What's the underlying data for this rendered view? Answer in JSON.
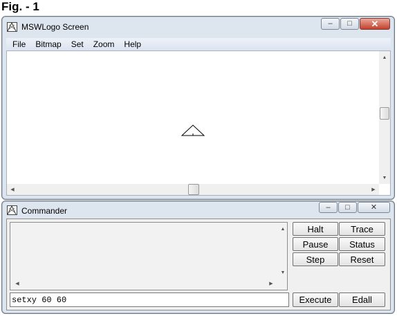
{
  "caption": "Fig. - 1",
  "screen_window": {
    "title": "MSWLogo Screen",
    "menu": [
      "File",
      "Bitmap",
      "Set",
      "Zoom",
      "Help"
    ]
  },
  "commander_window": {
    "title": "Commander",
    "buttons": {
      "halt": "Halt",
      "trace": "Trace",
      "pause": "Pause",
      "status": "Status",
      "step": "Step",
      "reset": "Reset",
      "execute": "Execute",
      "edall": "Edall"
    },
    "input_value": "setxy 60 60"
  },
  "window_controls": {
    "minimize": "–",
    "maximize": "□",
    "close": "✕"
  },
  "icons": {
    "app": "logo-app-icon",
    "turtle": "turtle-triangle-icon"
  }
}
